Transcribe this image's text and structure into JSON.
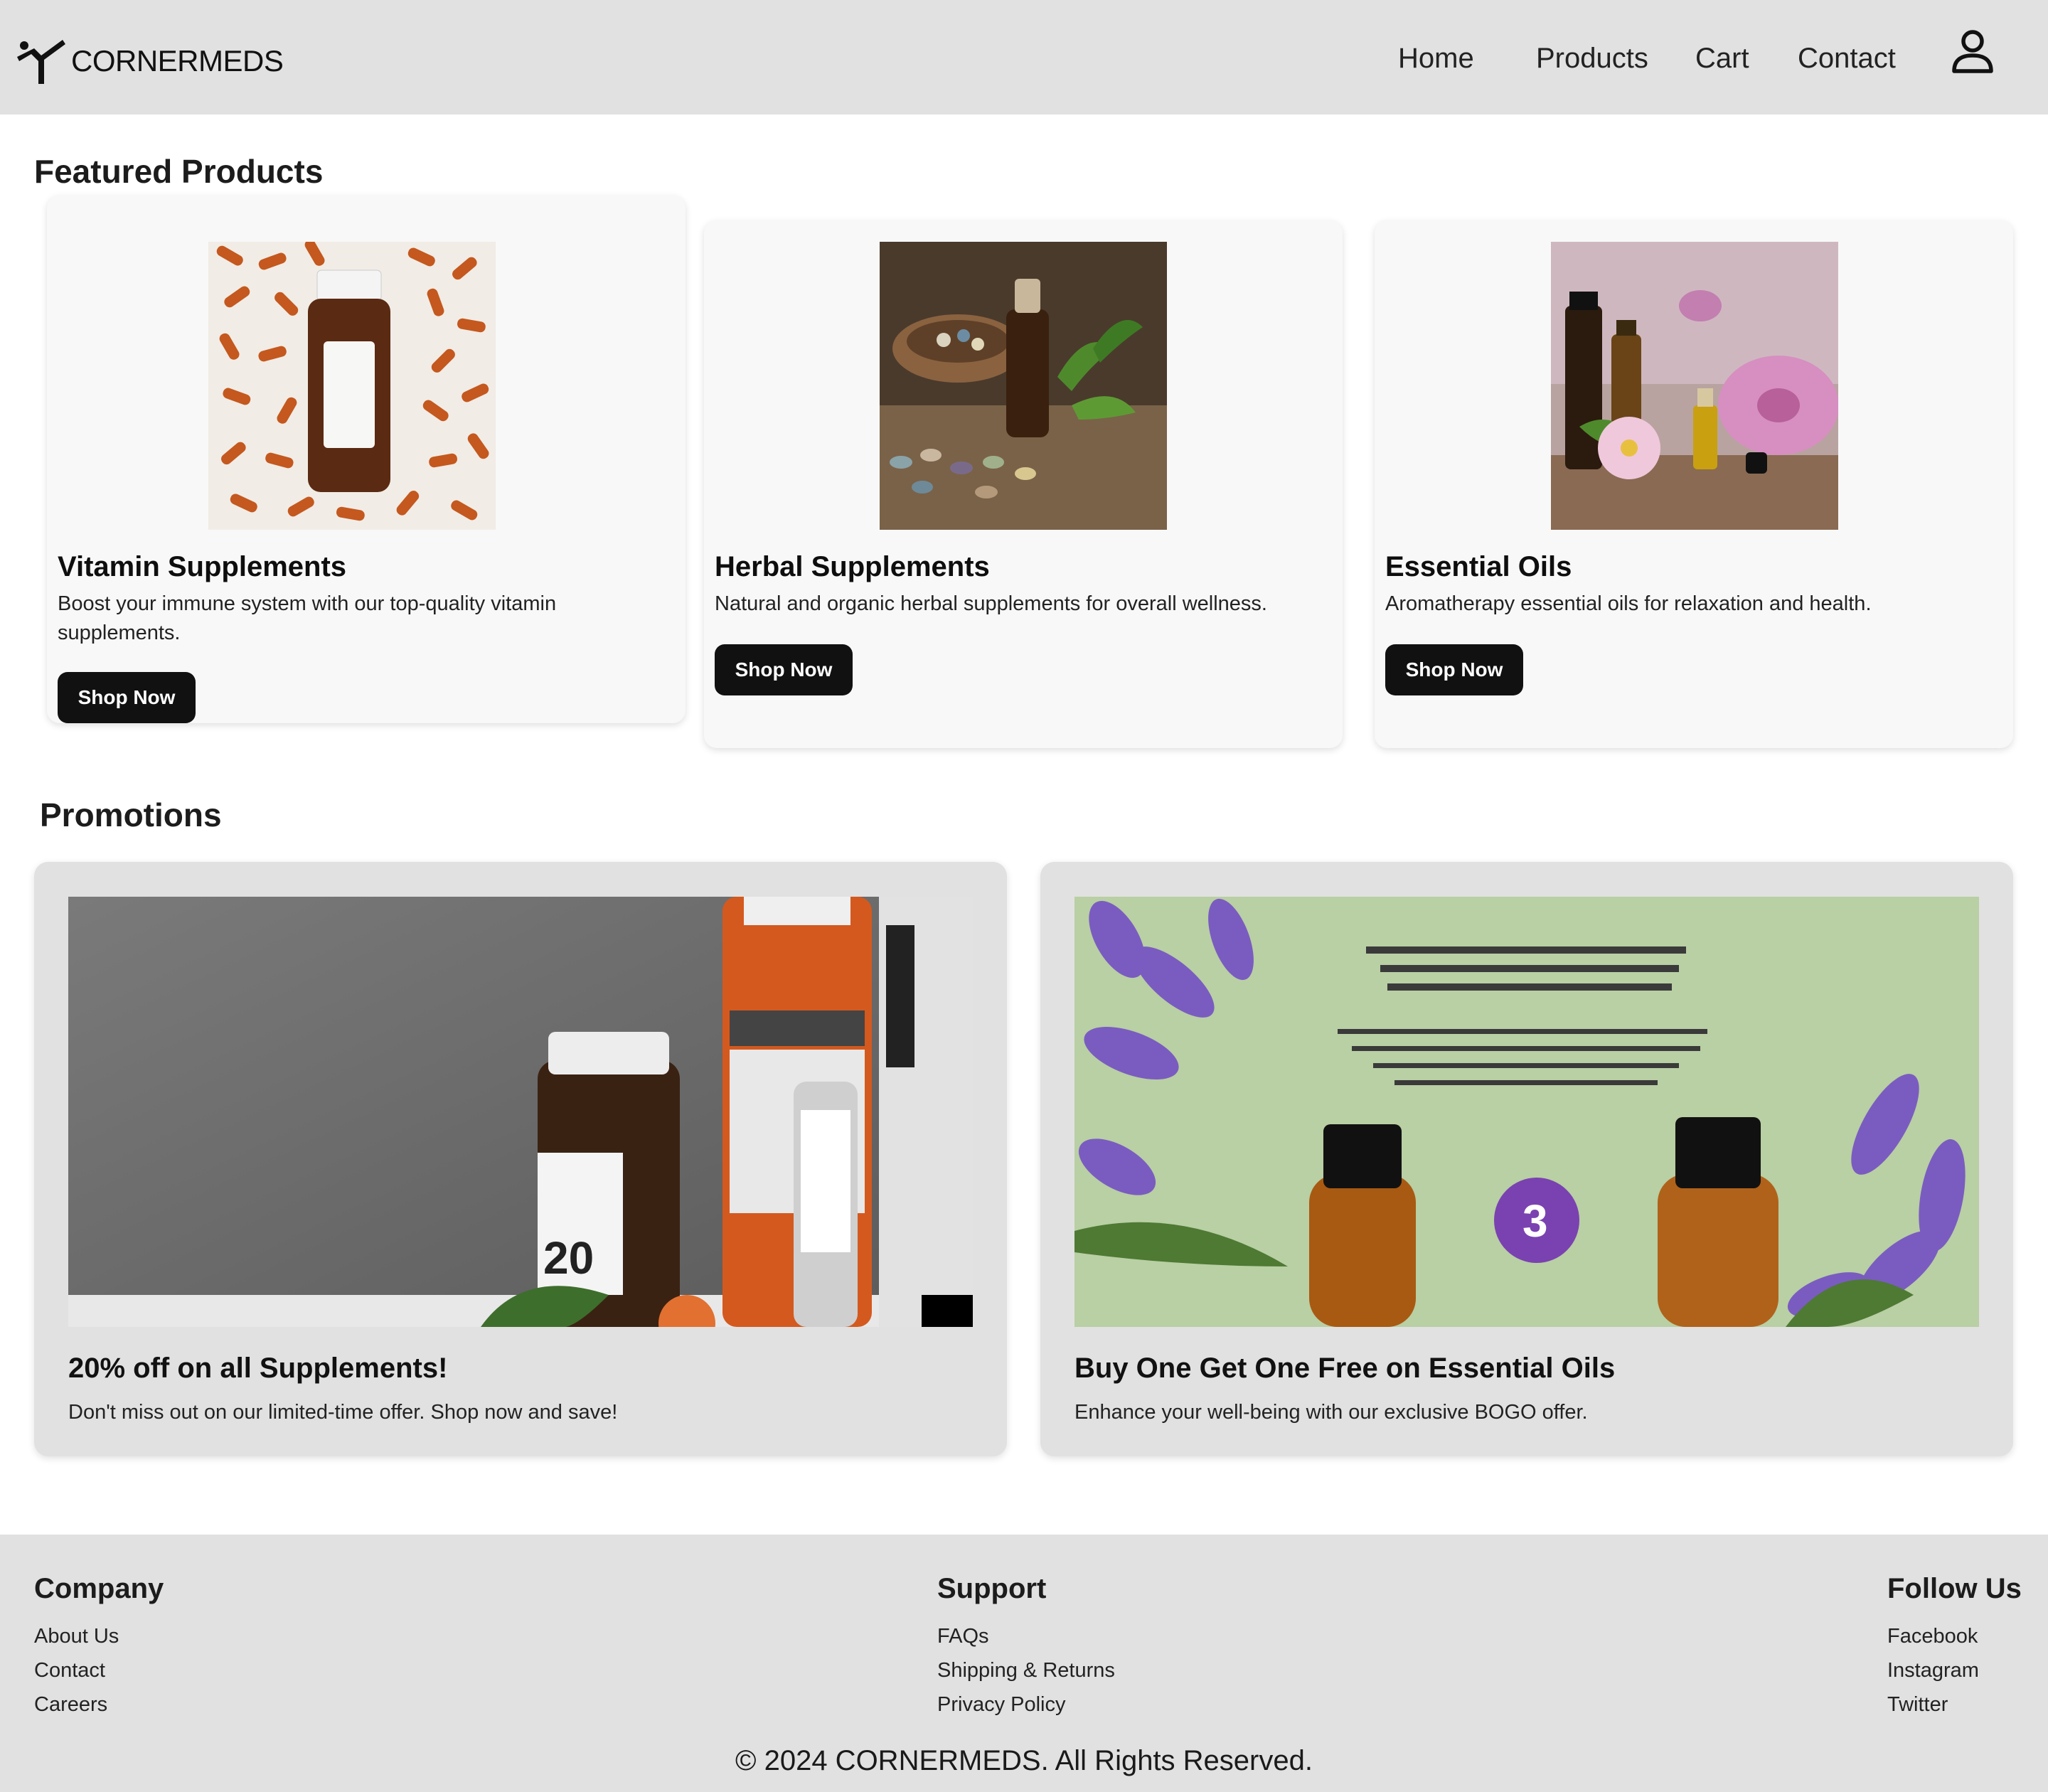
{
  "header": {
    "brand": "CORNERMEDS",
    "nav": [
      {
        "label": "Home"
      },
      {
        "label": "Products"
      },
      {
        "label": "Cart"
      },
      {
        "label": "Contact"
      }
    ],
    "user_icon": "user-icon"
  },
  "featured": {
    "title": "Featured Products",
    "products": [
      {
        "title": "Vitamin Supplements",
        "description": "Boost your immune system with our top-quality vitamin supplements.",
        "button": "Shop Now",
        "image_icon": "vitamin-bottle-image"
      },
      {
        "title": "Herbal Supplements",
        "description": "Natural and organic herbal supplements for overall wellness.",
        "button": "Shop Now",
        "image_icon": "herbal-supplements-image"
      },
      {
        "title": "Essential Oils",
        "description": "Aromatherapy essential oils for relaxation and health.",
        "button": "Shop Now",
        "image_icon": "essential-oils-image"
      }
    ]
  },
  "promotions": {
    "title": "Promotions",
    "items": [
      {
        "title": "20% off on all Supplements!",
        "description": "Don't miss out on our limited-time offer. Shop now and save!",
        "image_icon": "supplement-bottles-image"
      },
      {
        "title": "Buy One Get One Free on Essential Oils",
        "description": "Enhance your well-being with our exclusive BOGO offer.",
        "image_icon": "lavender-oils-image"
      }
    ]
  },
  "footer": {
    "columns": [
      {
        "heading": "Company",
        "links": [
          "About Us",
          "Contact",
          "Careers"
        ]
      },
      {
        "heading": "Support",
        "links": [
          "FAQs",
          "Shipping & Returns",
          "Privacy Policy"
        ]
      },
      {
        "heading": "Follow Us",
        "links": [
          "Facebook",
          "Instagram",
          "Twitter"
        ]
      }
    ],
    "copyright": "© 2024 CORNERMEDS. All Rights Reserved."
  },
  "colors": {
    "header_bg": "#e1e1e1",
    "button_bg": "#111111",
    "card_bg": "#f8f8f8",
    "promo_bg": "#e1e1e1"
  }
}
